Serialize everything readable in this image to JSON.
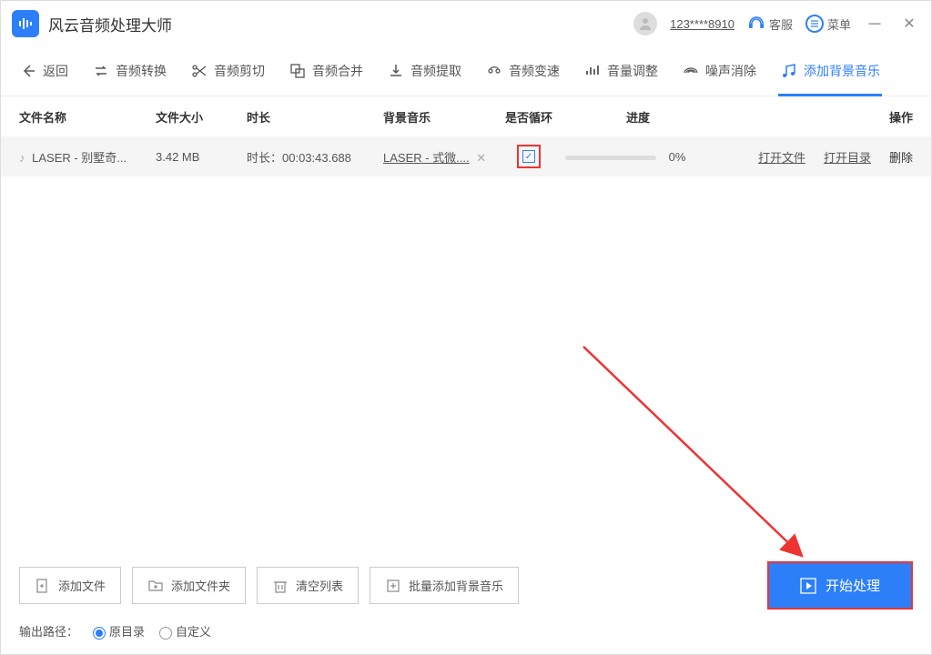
{
  "titlebar": {
    "app_name": "风云音频处理大师",
    "account": "123****8910",
    "support": "客服",
    "menu": "菜单"
  },
  "toolbar": {
    "back": "返回",
    "items": [
      {
        "label": "音频转换"
      },
      {
        "label": "音频剪切"
      },
      {
        "label": "音频合并"
      },
      {
        "label": "音频提取"
      },
      {
        "label": "音频变速"
      },
      {
        "label": "音量调整"
      },
      {
        "label": "噪声消除"
      },
      {
        "label": "添加背景音乐"
      }
    ]
  },
  "columns": {
    "name": "文件名称",
    "size": "文件大小",
    "duration": "时长",
    "bgm": "背景音乐",
    "loop": "是否循环",
    "progress": "进度",
    "actions": "操作"
  },
  "rows": [
    {
      "name": "LASER - 别墅奇...",
      "size": "3.42 MB",
      "duration": "时长：00:03:43.688",
      "bgm": "LASER - 式微....",
      "loop_checked": true,
      "progress": "0%",
      "open_file": "打开文件",
      "open_dir": "打开目录",
      "delete": "删除"
    }
  ],
  "footer": {
    "add_file": "添加文件",
    "add_folder": "添加文件夹",
    "clear_list": "清空列表",
    "batch_bgm": "批量添加背景音乐",
    "start": "开始处理",
    "output_path": "输出路径：",
    "original_dir": "原目录",
    "custom": "自定义"
  }
}
